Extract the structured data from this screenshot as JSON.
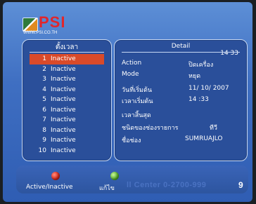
{
  "brand": {
    "name": "PSI",
    "url": "WWW.PSI.CO.TH"
  },
  "timer_list": {
    "title": "ตั้งเวลา",
    "items": [
      {
        "num": "1",
        "status": "Inactive",
        "selected": true
      },
      {
        "num": "2",
        "status": "Inactive",
        "selected": false
      },
      {
        "num": "3",
        "status": "Inactive",
        "selected": false
      },
      {
        "num": "4",
        "status": "Inactive",
        "selected": false
      },
      {
        "num": "5",
        "status": "Inactive",
        "selected": false
      },
      {
        "num": "6",
        "status": "Inactive",
        "selected": false
      },
      {
        "num": "7",
        "status": "Inactive",
        "selected": false
      },
      {
        "num": "8",
        "status": "Inactive",
        "selected": false
      },
      {
        "num": "9",
        "status": "Inactive",
        "selected": false
      },
      {
        "num": "10",
        "status": "Inactive",
        "selected": false
      }
    ]
  },
  "detail": {
    "title": "Detail",
    "clock": "14 33",
    "rows": [
      {
        "label": "Action",
        "value": "ปิดเครื่อง"
      },
      {
        "label": "Mode",
        "value": "หยุด"
      },
      {
        "label": "วันที่เริ่มต้น",
        "value": "11/ 10/ 2007"
      },
      {
        "label": "เวลาเริ่มต้น",
        "value": "14 :33"
      },
      {
        "label": "เวลาสิ้นสุด",
        "value": ""
      },
      {
        "label": "ชนิดของช่องรายการ",
        "value": "ทีวี"
      },
      {
        "label": "ชื่อช่อง",
        "value": "SUMRUAJLO"
      }
    ]
  },
  "bottom_bar": {
    "red_label": "Active/Inactive",
    "green_label": "แก้ไข",
    "call_center": "ll Center  0-2700-999",
    "call_center_end": "9"
  },
  "colors": {
    "selected_row": "#d94a2a",
    "panel": "#2a4f9a",
    "background": "#3f6fc2",
    "red_button": "#e32a1a",
    "green_button": "#5ab82a"
  }
}
